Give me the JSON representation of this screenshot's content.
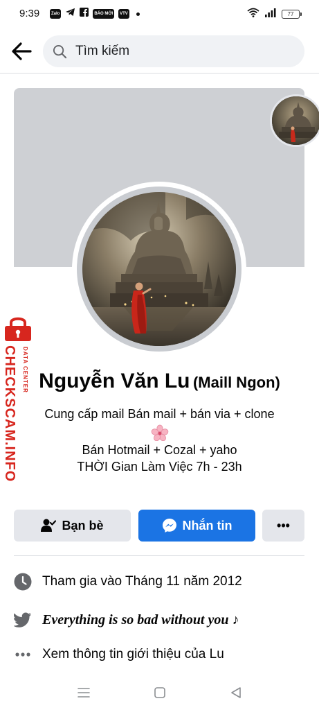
{
  "status_bar": {
    "time": "9:39",
    "notifications": [
      "Zalo",
      "telegram-icon",
      "facebook-icon",
      "BÁO MỚI",
      "VTV"
    ],
    "battery": "77"
  },
  "header": {
    "search_placeholder": "Tìm kiếm"
  },
  "watermark": {
    "brand": "CHECKSCAM.INFO",
    "sub": "DATA CENTER"
  },
  "profile": {
    "name": "Nguyễn Văn Lu",
    "alternate_name": "(Maill Ngon)",
    "bio": {
      "line1": "Cung cấp mail Bán mail + bán via + clone",
      "line2": "Bán Hotmail + Cozal + yaho",
      "line3": "THỜI Gian Làm Việc 7h - 23h"
    }
  },
  "actions": {
    "friends_label": "Bạn bè",
    "message_label": "Nhắn tin",
    "more_label": "•••"
  },
  "info": {
    "joined": "Tham gia vào Tháng 11 năm 2012",
    "twitter_status": "Everything is so bad without you ♪",
    "see_about": "Xem thông tin giới thiệu của Lu"
  },
  "colors": {
    "primary": "#1b74e4",
    "secondary_button": "#e4e6eb",
    "cover": "#ced0d4",
    "watermark_red": "#d7261e",
    "icon_gray": "#65676b"
  }
}
